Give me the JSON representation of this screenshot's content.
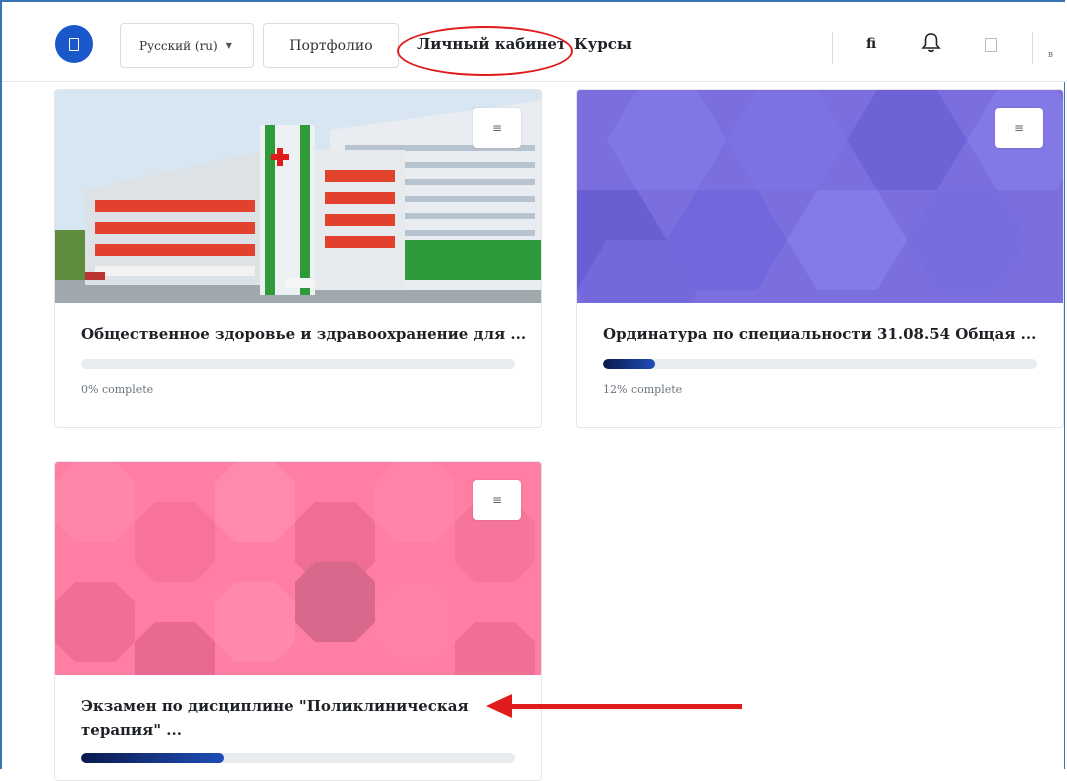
{
  "navbar": {
    "language": "Русский (ru)",
    "portfolio": "Портфолио",
    "personal_cabinet": "Личный кабинет",
    "courses": "Курсы",
    "messages_icon_text": "fi",
    "user_initials": "в"
  },
  "courses": [
    {
      "title": "Общественное здоровье и здравоохранение для ...",
      "progress_percent": 0,
      "progress_text": "0% complete",
      "image": "hospital-building-photo"
    },
    {
      "title": "Ординатура по специальности 31.08.54 Общая ...",
      "progress_percent": 12,
      "progress_text": "12% complete",
      "image": "purple-hexagon-pattern"
    },
    {
      "title_line1": "Экзамен по дисциплине \"Поликлиническая",
      "title_line2": "терапия\" ...",
      "progress_percent": 33,
      "image": "pink-octagon-pattern"
    }
  ],
  "colors": {
    "brand": "#1a57c9",
    "annotation": "#e01b1b",
    "purple_bg": "#7b6fe0",
    "pink_bg": "#ff7ea3"
  }
}
